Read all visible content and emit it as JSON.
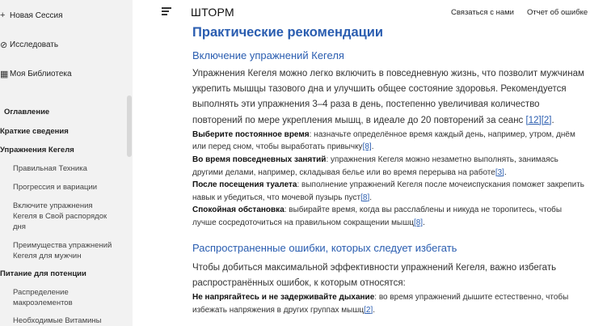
{
  "sidebar": {
    "actions": [
      {
        "icon": "plus-icon",
        "glyph": "+",
        "label": "Новая Сессия"
      },
      {
        "icon": "compass-icon",
        "glyph": "⊘",
        "label": "Исследовать"
      },
      {
        "icon": "library-icon",
        "glyph": "▦",
        "label": "Моя Библиотека"
      }
    ],
    "toc_title": "Оглавление",
    "toc": [
      {
        "type": "h",
        "label": "Краткие сведения"
      },
      {
        "type": "h",
        "label": "Упражнения Кегеля"
      },
      {
        "type": "sub",
        "label": "Правильная Техника"
      },
      {
        "type": "sub",
        "label": "Прогрессия и вариации"
      },
      {
        "type": "sub",
        "label": "Включите упражнения Кегеля в Свой распорядок дня"
      },
      {
        "type": "sub",
        "label": "Преимущества упражнений Кегеля для мужчин"
      },
      {
        "type": "h",
        "label": "Питание для потенции"
      },
      {
        "type": "sub",
        "label": "Распределение макроэлементов"
      },
      {
        "type": "sub",
        "label": "Необходимые Витамины"
      }
    ]
  },
  "header": {
    "brand": "ШТОРМ",
    "contact_link": "Связаться с нами",
    "report_link": "Отчет об ошибке"
  },
  "content": {
    "section_title": "Практические рекомендации",
    "sub1_title": "Включение упражнений Кегеля",
    "intro": {
      "text": "Упражнения Кегеля можно легко включить в повседневную жизнь, что позволит мужчинам укрепить мышцы тазового дна и улучшить общее состояние здоровья. Рекомендуется выполнять эти упражнения 3–4 раза в день, постепенно увеличивая количество повторений по мере укрепления мышц, в идеале до 20 повторений за сеанс ",
      "ref1": "[12]",
      "ref2": "[2]",
      "tail": "."
    },
    "tips": [
      {
        "bold": "Выберите постоянное время",
        "text": ": назначьте определённое время каждый день, например, утром, днём или перед сном, чтобы выработать привычку",
        "ref": "[8]",
        "tail": "."
      },
      {
        "bold": "Во время повседневных занятий",
        "text": ": упражнения Кегеля можно незаметно выполнять, занимаясь другими делами, например, складывая белье или во время перерыва на работе",
        "ref": "[3]",
        "tail": "."
      },
      {
        "bold": "После посещения туалета",
        "text": ": выполнение упражнений Кегеля после мочеиспускания поможет закрепить навык и убедиться, что мочевой пузырь пуст",
        "ref": "[8]",
        "tail": "."
      },
      {
        "bold": "Спокойная обстановка",
        "text": ": выбирайте время, когда вы расслаблены и никуда не торопитесь, чтобы лучше сосредоточиться на правильном сокращении мышц",
        "ref": "[8]",
        "tail": "."
      }
    ],
    "sub2_title": "Распространенные ошибки, которых следует избегать",
    "mistakes_intro": "Чтобы добиться максимальной эффективности упражнений Кегеля, важно избегать распространённых ошибок, к которым относятся:",
    "mistakes": [
      {
        "bold": "Не напрягайтесь и не задерживайте дыхание",
        "text": ": во время упражнений дышите естественно, чтобы избежать напряжения в других группах мышц",
        "ref": "[2]",
        "tail": "."
      }
    ]
  }
}
